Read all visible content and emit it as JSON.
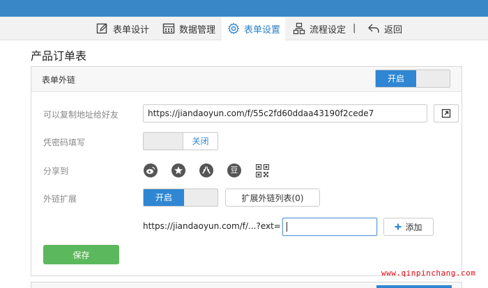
{
  "nav": {
    "form_design": "表单设计",
    "data_manage": "数据管理",
    "form_settings": "表单设置",
    "workflow": "流程设定",
    "separator": "|",
    "back": "返回"
  },
  "page": {
    "title": "产品订单表"
  },
  "panel": {
    "title": "表单外链",
    "toggle": {
      "on_label": "开启",
      "state": "on"
    }
  },
  "fields": {
    "copy_label": "可以复制地址给好友",
    "url_value": "https://jiandaoyun.com/f/55c2fd60ddaa43190f2cede7",
    "password_label": "凭密码填写",
    "password_toggle": {
      "off_label": "关闭",
      "state": "off"
    },
    "share_label": "分享到",
    "share_icons": [
      "weibo-icon",
      "star-icon",
      "renren-icon",
      "douban-icon",
      "qrcode-icon"
    ],
    "douban_glyph": "豆",
    "ext_label": "外链扩展",
    "ext_toggle": {
      "on_label": "开启",
      "state": "on"
    },
    "ext_list_button": "扩展外链列表(0)",
    "ext_prefix": "https://jiandaoyun.com/f/...?ext=",
    "ext_input_value": "",
    "add_button": "添加",
    "save_button": "保存"
  },
  "watermark": "www.qinpinchang.com",
  "colors": {
    "topbar": "#3a87c8",
    "accent": "#2f86d2",
    "save": "#5cb85c",
    "watermark": "#e8000b"
  }
}
